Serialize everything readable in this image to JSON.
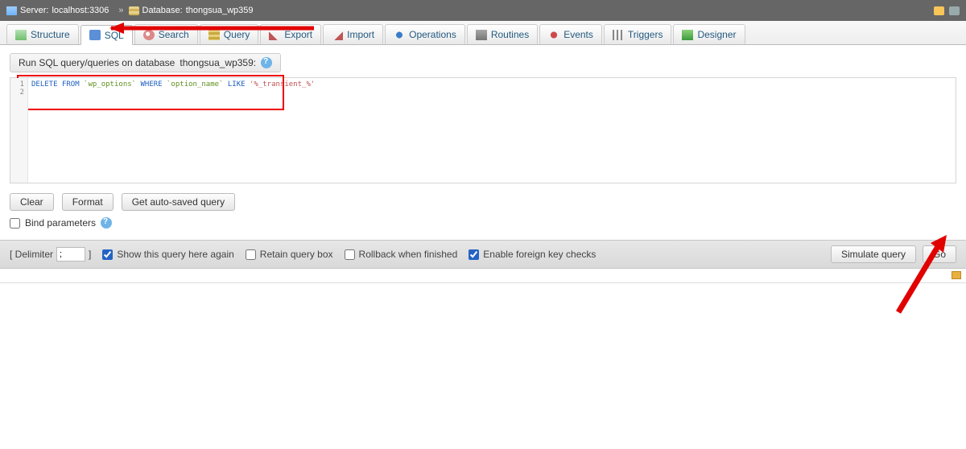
{
  "breadcrumb": {
    "server_label": "Server:",
    "server_value": "localhost:3306",
    "database_label": "Database:",
    "database_value": "thongsua_wp359"
  },
  "tabs": [
    {
      "id": "structure",
      "label": "Structure"
    },
    {
      "id": "sql",
      "label": "SQL"
    },
    {
      "id": "search",
      "label": "Search"
    },
    {
      "id": "query",
      "label": "Query"
    },
    {
      "id": "export",
      "label": "Export"
    },
    {
      "id": "import",
      "label": "Import"
    },
    {
      "id": "operations",
      "label": "Operations"
    },
    {
      "id": "routines",
      "label": "Routines"
    },
    {
      "id": "events",
      "label": "Events"
    },
    {
      "id": "triggers",
      "label": "Triggers"
    },
    {
      "id": "designer",
      "label": "Designer"
    }
  ],
  "active_tab": "sql",
  "panel": {
    "title_prefix": "Run SQL query/queries on database",
    "title_db": "thongsua_wp359:"
  },
  "editor": {
    "line1": {
      "kw1": "DELETE",
      "kw2": "FROM",
      "t1": "`wp_options`",
      "kw3": "WHERE",
      "t2": "`option_name`",
      "kw4": "LIKE",
      "s": "'%_transient_%'"
    },
    "line_numbers": [
      "1",
      "2"
    ]
  },
  "buttons": {
    "clear": "Clear",
    "format": "Format",
    "autosaved": "Get auto-saved query",
    "bind": "Bind parameters",
    "simulate": "Simulate query",
    "go": "Go"
  },
  "footer": {
    "delimiter_label_open": "[ Delimiter",
    "delimiter_value": ";",
    "delimiter_label_close": "]",
    "show_again": "Show this query here again",
    "retain": "Retain query box",
    "rollback": "Rollback when finished",
    "fk": "Enable foreign key checks"
  },
  "checks": {
    "show_again": true,
    "retain": false,
    "rollback": false,
    "fk": true,
    "bind": false
  }
}
